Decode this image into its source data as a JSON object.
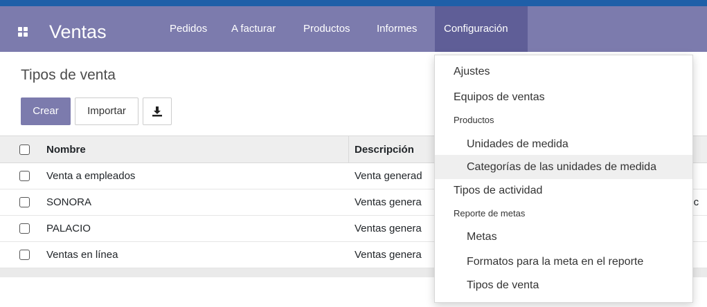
{
  "navbar": {
    "brand": "Ventas",
    "menu": [
      "Pedidos",
      "A facturar",
      "Productos",
      "Informes",
      "Configuración"
    ]
  },
  "page": {
    "title": "Tipos de venta",
    "create_label": "Crear",
    "import_label": "Importar"
  },
  "table": {
    "columns": [
      "Nombre",
      "Descripción"
    ],
    "rows": [
      {
        "name": "Venta a empleados",
        "desc": "Venta generad"
      },
      {
        "name": "SONORA",
        "desc": "Ventas genera"
      },
      {
        "name": "PALACIO",
        "desc": "Ventas genera"
      },
      {
        "name": "Ventas en línea",
        "desc": "Ventas genera"
      }
    ],
    "overflow_fragment": "onc"
  },
  "dropdown": {
    "ajustes": "Ajustes",
    "equipos": "Equipos de ventas",
    "productos_header": "Productos",
    "unidades": "Unidades de medida",
    "categorias": "Categorías de las unidades de medida",
    "tipos_actividad": "Tipos de actividad",
    "reporte_header": "Reporte de metas",
    "metas": "Metas",
    "formatos": "Formatos para la meta en el reporte",
    "tipos_venta": "Tipos de venta"
  },
  "colors": {
    "navbar": "#7c7bad",
    "navbar_active": "#5f5e97",
    "top_strip": "#1f5fa8"
  }
}
